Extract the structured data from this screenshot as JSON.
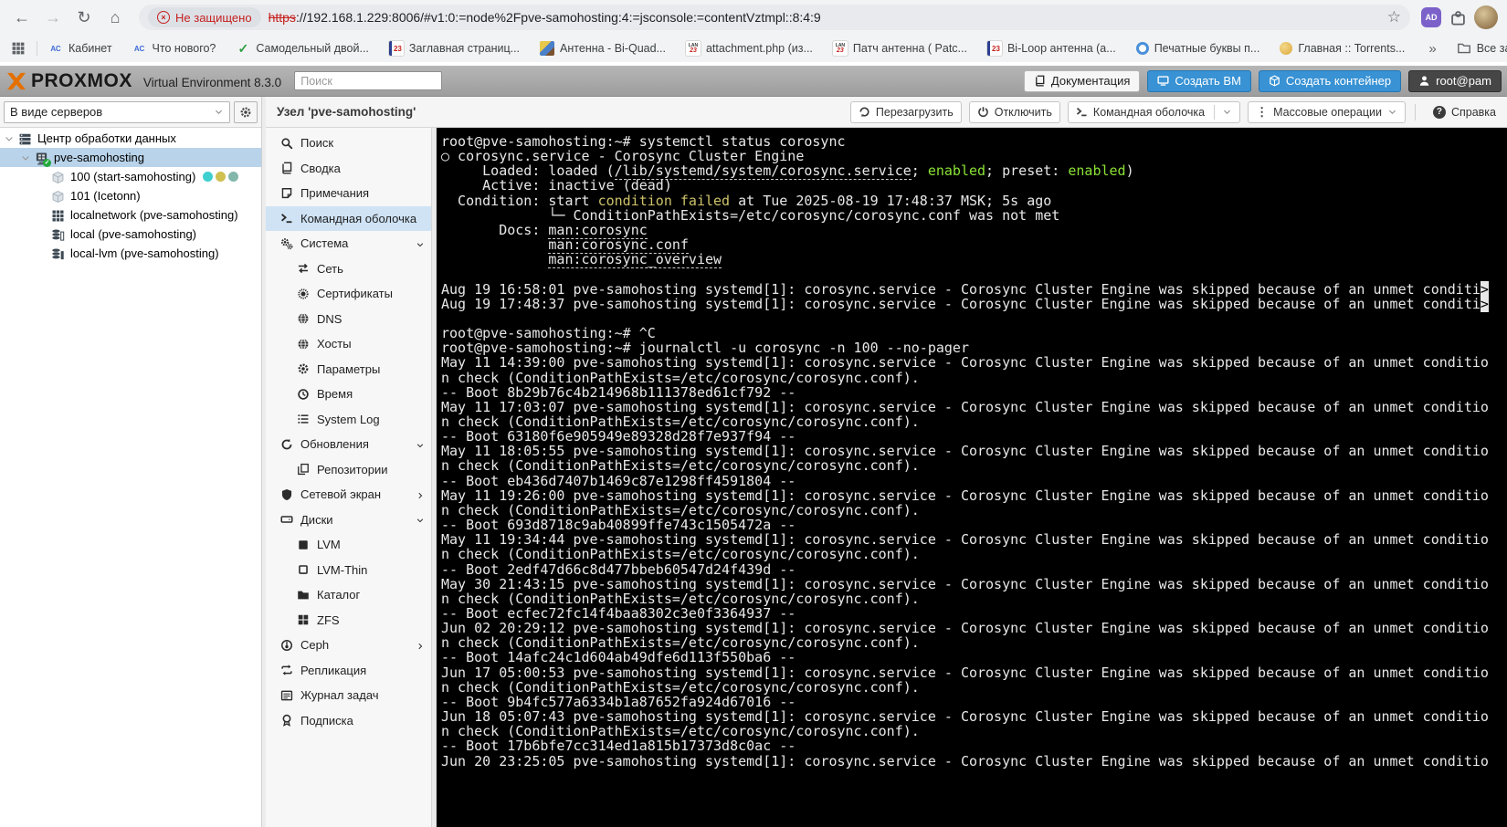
{
  "colors": {
    "pve_blue": "#3892d4",
    "tree_selection": "#b9d4ea",
    "menu_selection": "#cfe3f5",
    "badge_red": "#c5221f",
    "terminal_green": "#8ae234",
    "terminal_yellow": "#cdc26a",
    "terminal_bg": "#000000"
  },
  "browser": {
    "icons": {
      "back": "←",
      "forward": "→",
      "reload": "↻",
      "home": "⌂",
      "star": "☆",
      "overflow": "»",
      "adblock": "AD"
    },
    "security_badge": "Не защищено",
    "url_scheme": "https",
    "url_rest": "://192.168.1.229:8006/#v1:0:=node%2Fpve-samohosting:4:=jsconsole:=contentVztmpl::8:4:9",
    "bookmarks": [
      {
        "key": "kabinet",
        "label": "Кабинет",
        "fav": "txt",
        "fav_text": "АС",
        "fav_color": "#3f6bd8"
      },
      {
        "key": "whats-new",
        "label": "Что нового?",
        "fav": "txt",
        "fav_text": "АС",
        "fav_color": "#3f6bd8"
      },
      {
        "key": "samodelny-dvoi",
        "label": "Самодельный двой...",
        "fav": "check",
        "fav_text": "✓"
      },
      {
        "key": "zaglavnaya",
        "label": "Заглавная страниц...",
        "fav": "n23",
        "fav_text": "23"
      },
      {
        "key": "antenna-biquad",
        "label": "Антенна - Bi-Quad...",
        "fav": "img",
        "fav_text": ""
      },
      {
        "key": "attachment-php",
        "label": "attachment.php (из...",
        "fav": "lan",
        "fav_text": "LAN",
        "fav_text2": "23"
      },
      {
        "key": "patch-antenna",
        "label": "Патч антенна ( Patc...",
        "fav": "lan",
        "fav_text": "LAN",
        "fav_text2": "23"
      },
      {
        "key": "biloop-antenna",
        "label": "Bi-Loop антенна (а...",
        "fav": "n23",
        "fav_text": "23"
      },
      {
        "key": "pechatnye-bukvy",
        "label": "Печатные буквы п...",
        "fav": "target",
        "fav_text": ""
      },
      {
        "key": "torrents-home",
        "label": "Главная :: Torrents...",
        "fav": "dot",
        "fav_text": ""
      }
    ],
    "all_bookmarks_label": "Все закладки"
  },
  "header": {
    "brand": "PROXMOX",
    "subtitle": "Virtual Environment 8.3.0",
    "search_placeholder": "Поиск",
    "buttons": [
      {
        "key": "documentation",
        "label": "Документация",
        "style": "light",
        "icon": "book"
      },
      {
        "key": "create-vm",
        "label": "Создать ВМ",
        "style": "blue",
        "icon": "monitor"
      },
      {
        "key": "create-ct",
        "label": "Создать контейнер",
        "style": "blue",
        "icon": "cube"
      },
      {
        "key": "user-menu",
        "label": "root@pam",
        "style": "dark",
        "icon": "user"
      }
    ]
  },
  "resource_tree": {
    "view_selector": "В виде серверов",
    "items": [
      {
        "key": "datacenter",
        "label": "Центр обработки данных",
        "icon": "dc",
        "level": 0,
        "expanded": true
      },
      {
        "key": "node-pve-samohosting",
        "label": "pve-samohosting",
        "icon": "node",
        "level": 1,
        "expanded": true,
        "selected": true,
        "check": true
      },
      {
        "key": "vm-100",
        "label": "100 (start-samohosting)",
        "icon": "vm",
        "level": 2,
        "tags": [
          "#3ecfcf",
          "#cfc050",
          "#83b7ac"
        ]
      },
      {
        "key": "vm-101",
        "label": "101 (Icetonn)",
        "icon": "vm",
        "level": 2
      },
      {
        "key": "sdn-localnetwork",
        "label": "localnetwork (pve-samohosting)",
        "icon": "netgrid",
        "level": 2
      },
      {
        "key": "storage-local",
        "label": "local (pve-samohosting)",
        "icon": "dbo",
        "level": 2
      },
      {
        "key": "storage-local-lvm",
        "label": "local-lvm (pve-samohosting)",
        "icon": "dbf",
        "level": 2
      }
    ]
  },
  "content_header": {
    "title": "Узел 'pve-samohosting'",
    "buttons": [
      {
        "key": "reboot",
        "label": "Перезагрузить",
        "icon": "restart"
      },
      {
        "key": "shutdown",
        "label": "Отключить",
        "icon": "power"
      },
      {
        "key": "shell",
        "label": "Командная оболочка",
        "icon": "term",
        "split": true
      },
      {
        "key": "bulk-actions",
        "label": "Массовые операции",
        "icon": "bulk",
        "caret": true
      },
      {
        "key": "help",
        "label": "Справка",
        "icon": "help",
        "plain": true,
        "divider": true
      }
    ]
  },
  "node_menu": {
    "items": [
      {
        "key": "search",
        "label": "Поиск",
        "icon": "search",
        "level": 0
      },
      {
        "key": "summary",
        "label": "Сводка",
        "icon": "book",
        "level": 0
      },
      {
        "key": "notes",
        "label": "Примечания",
        "icon": "note",
        "level": 0
      },
      {
        "key": "shell",
        "label": "Командная оболочка",
        "icon": "term",
        "level": 0,
        "selected": true
      },
      {
        "key": "system",
        "label": "Система",
        "icon": "gears",
        "level": 0,
        "caret": "down"
      },
      {
        "key": "network",
        "label": "Сеть",
        "icon": "net",
        "level": 1
      },
      {
        "key": "certificates",
        "label": "Сертификаты",
        "icon": "cert",
        "level": 1
      },
      {
        "key": "dns",
        "label": "DNS",
        "icon": "globe",
        "level": 1
      },
      {
        "key": "hosts",
        "label": "Хосты",
        "icon": "globe",
        "level": 1
      },
      {
        "key": "options",
        "label": "Параметры",
        "icon": "gear",
        "level": 1
      },
      {
        "key": "time",
        "label": "Время",
        "icon": "clock",
        "level": 1
      },
      {
        "key": "syslog",
        "label": "System Log",
        "icon": "list",
        "level": 1
      },
      {
        "key": "updates",
        "label": "Обновления",
        "icon": "refresh",
        "level": 0,
        "caret": "down"
      },
      {
        "key": "repositories",
        "label": "Репозитории",
        "icon": "copy",
        "level": 1
      },
      {
        "key": "firewall",
        "label": "Сетевой экран",
        "icon": "shield",
        "level": 0,
        "caret": "right"
      },
      {
        "key": "disks",
        "label": "Диски",
        "icon": "hdd",
        "level": 0,
        "caret": "down"
      },
      {
        "key": "lvm",
        "label": "LVM",
        "icon": "sqf",
        "level": 1
      },
      {
        "key": "lvmthin",
        "label": "LVM-Thin",
        "icon": "sqo",
        "level": 1
      },
      {
        "key": "directory",
        "label": "Каталог",
        "icon": "folder",
        "level": 1
      },
      {
        "key": "zfs",
        "label": "ZFS",
        "icon": "zfs",
        "level": 1
      },
      {
        "key": "ceph",
        "label": "Ceph",
        "icon": "ceph",
        "level": 0,
        "caret": "right"
      },
      {
        "key": "replication",
        "label": "Репликация",
        "icon": "repl",
        "level": 0
      },
      {
        "key": "tasklog",
        "label": "Журнал задач",
        "icon": "journal",
        "level": 0
      },
      {
        "key": "subscription",
        "label": "Подписка",
        "icon": "sub",
        "level": 0
      }
    ]
  },
  "terminal": {
    "lines": [
      [
        {
          "t": "root@pve-samohosting:~# systemctl status corosync"
        }
      ],
      [
        {
          "t": "○ corosync.service - Corosync Cluster Engine"
        }
      ],
      [
        {
          "t": "     Loaded: loaded ("
        },
        {
          "s": "u",
          "t": "/lib/systemd/system/corosync.service"
        },
        {
          "t": "; "
        },
        {
          "s": "g",
          "t": "enabled"
        },
        {
          "t": "; preset: "
        },
        {
          "s": "g",
          "t": "enabled"
        },
        {
          "t": ")"
        }
      ],
      [
        {
          "t": "     Active: inactive (dead)"
        }
      ],
      [
        {
          "t": "  Condition: start "
        },
        {
          "s": "y",
          "t": "condition failed"
        },
        {
          "t": " at Tue 2025-08-19 17:48:37 MSK; 5s ago"
        }
      ],
      [
        {
          "t": "             └─ ConditionPathExists=/etc/corosync/corosync.conf was not met"
        }
      ],
      [
        {
          "t": "       Docs: "
        },
        {
          "s": "u",
          "t": "man:corosync"
        }
      ],
      [
        {
          "t": "             "
        },
        {
          "s": "u",
          "t": "man:corosync.conf"
        }
      ],
      [
        {
          "t": "             "
        },
        {
          "s": "u",
          "t": "man:corosync_overview"
        }
      ],
      [],
      [
        {
          "t": "Aug 19 16:58:01 pve-samohosting systemd[1]: corosync.service - Corosync Cluster Engine was skipped because of an unmet conditi"
        },
        {
          "s": "v",
          "t": ">"
        }
      ],
      [
        {
          "t": "Aug 19 17:48:37 pve-samohosting systemd[1]: corosync.service - Corosync Cluster Engine was skipped because of an unmet conditi"
        },
        {
          "s": "v",
          "t": ">"
        }
      ],
      [],
      [
        {
          "t": "root@pve-samohosting:~# ^C"
        }
      ],
      [
        {
          "t": "root@pve-samohosting:~# journalctl -u corosync -n 100 --no-pager"
        }
      ],
      [
        {
          "t": "May 11 14:39:00 pve-samohosting systemd[1]: corosync.service - Corosync Cluster Engine was skipped because of an unmet conditio"
        }
      ],
      [
        {
          "t": "n check (ConditionPathExists=/etc/corosync/corosync.conf)."
        }
      ],
      [
        {
          "t": "-- Boot 8b29b76c4b214968b111378ed61cf792 --"
        }
      ],
      [
        {
          "t": "May 11 17:03:07 pve-samohosting systemd[1]: corosync.service - Corosync Cluster Engine was skipped because of an unmet conditio"
        }
      ],
      [
        {
          "t": "n check (ConditionPathExists=/etc/corosync/corosync.conf)."
        }
      ],
      [
        {
          "t": "-- Boot 63180f6e905949e89328d28f7e937f94 --"
        }
      ],
      [
        {
          "t": "May 11 18:05:55 pve-samohosting systemd[1]: corosync.service - Corosync Cluster Engine was skipped because of an unmet conditio"
        }
      ],
      [
        {
          "t": "n check (ConditionPathExists=/etc/corosync/corosync.conf)."
        }
      ],
      [
        {
          "t": "-- Boot eb436d7407b1469c87e1298ff4591804 --"
        }
      ],
      [
        {
          "t": "May 11 19:26:00 pve-samohosting systemd[1]: corosync.service - Corosync Cluster Engine was skipped because of an unmet conditio"
        }
      ],
      [
        {
          "t": "n check (ConditionPathExists=/etc/corosync/corosync.conf)."
        }
      ],
      [
        {
          "t": "-- Boot 693d8718c9ab40899ffe743c1505472a --"
        }
      ],
      [
        {
          "t": "May 11 19:34:44 pve-samohosting systemd[1]: corosync.service - Corosync Cluster Engine was skipped because of an unmet conditio"
        }
      ],
      [
        {
          "t": "n check (ConditionPathExists=/etc/corosync/corosync.conf)."
        }
      ],
      [
        {
          "t": "-- Boot 2edf47d66c8d477bbeb60547d24f439d --"
        }
      ],
      [
        {
          "t": "May 30 21:43:15 pve-samohosting systemd[1]: corosync.service - Corosync Cluster Engine was skipped because of an unmet conditio"
        }
      ],
      [
        {
          "t": "n check (ConditionPathExists=/etc/corosync/corosync.conf)."
        }
      ],
      [
        {
          "t": "-- Boot ecfec72fc14f4baa8302c3e0f3364937 --"
        }
      ],
      [
        {
          "t": "Jun 02 20:29:12 pve-samohosting systemd[1]: corosync.service - Corosync Cluster Engine was skipped because of an unmet conditio"
        }
      ],
      [
        {
          "t": "n check (ConditionPathExists=/etc/corosync/corosync.conf)."
        }
      ],
      [
        {
          "t": "-- Boot 14afc24c1d604ab49dfe6d113f550ba6 --"
        }
      ],
      [
        {
          "t": "Jun 17 05:00:53 pve-samohosting systemd[1]: corosync.service - Corosync Cluster Engine was skipped because of an unmet conditio"
        }
      ],
      [
        {
          "t": "n check (ConditionPathExists=/etc/corosync/corosync.conf)."
        }
      ],
      [
        {
          "t": "-- Boot 9b4fc577a6334b1a87652fa924d67016 --"
        }
      ],
      [
        {
          "t": "Jun 18 05:07:43 pve-samohosting systemd[1]: corosync.service - Corosync Cluster Engine was skipped because of an unmet conditio"
        }
      ],
      [
        {
          "t": "n check (ConditionPathExists=/etc/corosync/corosync.conf)."
        }
      ],
      [
        {
          "t": "-- Boot 17b6bfe7cc314ed1a815b17373d8c0ac --"
        }
      ],
      [
        {
          "t": "Jun 20 23:25:05 pve-samohosting systemd[1]: corosync.service - Corosync Cluster Engine was skipped because of an unmet conditio"
        }
      ]
    ]
  }
}
